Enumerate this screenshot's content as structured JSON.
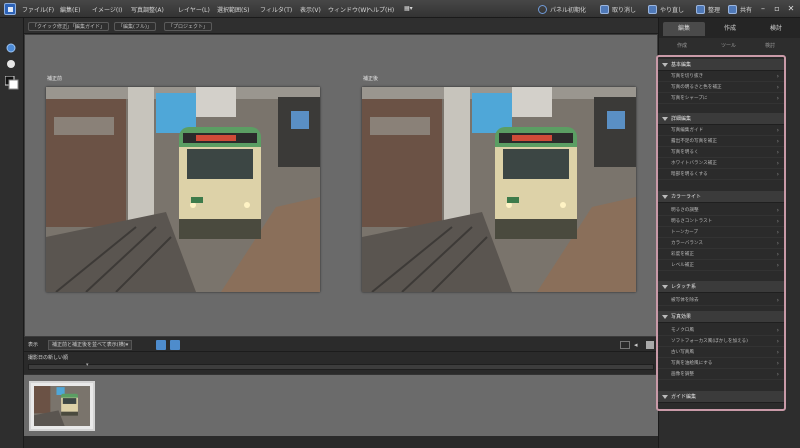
{
  "menubar": {
    "items": [
      "ファイル(F)",
      "編集(E)",
      "イメージ(I)",
      "写真調整(A)",
      "レイヤー(L)",
      "選択範囲(S)",
      "フィルタ(T)",
      "表示(V)",
      "ウィンドウ(W)",
      "ヘルプ(H)",
      "▦▾"
    ],
    "buttons": [
      {
        "label": "パネル初期化",
        "icon": "refresh-icon"
      },
      {
        "label": "取り消し",
        "icon": "undo-icon"
      },
      {
        "label": "やり直し",
        "icon": "redo-icon"
      },
      {
        "label": "整理",
        "icon": "organize-icon"
      },
      {
        "label": "共有",
        "icon": "share-icon"
      }
    ],
    "window_controls": [
      "–",
      "▫",
      "✕"
    ]
  },
  "subbar": {
    "tabs": [
      "「クイック修正」",
      "「編集ガイド」",
      "「編集(フル)」",
      "「プロジェクト」"
    ]
  },
  "workspace": {
    "before_label": "補正前",
    "after_label": "補正後"
  },
  "infobar": {
    "zoom_label": "表示",
    "view_select": "補正前と補正後を並べて表示(横)▾"
  },
  "sortbar": {
    "label": "撮影日の新しい順",
    "select": "▾"
  },
  "right_panel": {
    "tabs": [
      "編集",
      "作成",
      "検討"
    ],
    "subtabs": [
      "作成",
      "ツール",
      "検討"
    ],
    "sections": [
      {
        "title": "基本編集",
        "items": [
          "写真を切り抜き",
          "写真の明るさと色を補正",
          "写真をシャープに"
        ]
      },
      {
        "title": "詳細編集",
        "items": [
          "写真編集ガイド",
          "露出不足の写真を補正",
          "写真を明るく",
          "ホワイトバランス補正",
          "暗部を明るくする"
        ]
      },
      {
        "title": "カラーライト",
        "items": [
          "明るさの調整",
          "明るさコントラスト",
          "トーンカーブ",
          "カラーバランス",
          "彩度を補正",
          "レベル補正"
        ]
      },
      {
        "title": "レタッチ系",
        "items": [
          "被写体を除去"
        ]
      },
      {
        "title": "写真効果",
        "items": [
          "モノクロ風",
          "ソフトフォーカス風(ぼかしを加える)",
          "古い写真風",
          "写真を油絵風にする",
          "画像を調整"
        ]
      },
      {
        "title": "ガイド編集",
        "items": []
      }
    ]
  },
  "colors": {
    "accent_border": "#c99aa8",
    "workspace_bg": "#6a6a6a",
    "panel_bg": "#2d2d2d"
  }
}
